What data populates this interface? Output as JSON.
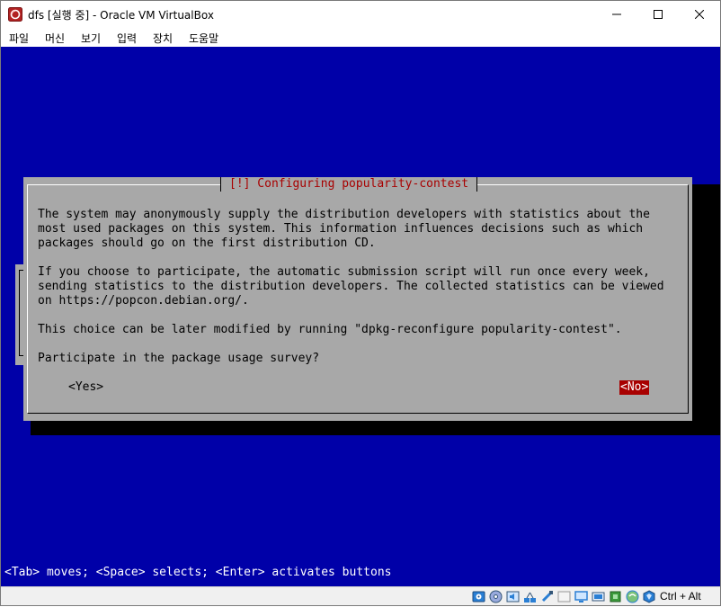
{
  "window": {
    "title": "dfs [실행 중] - Oracle VM VirtualBox",
    "accent_color": "#b22222"
  },
  "menu": {
    "items": [
      {
        "label": "파일"
      },
      {
        "label": "머신"
      },
      {
        "label": "보기"
      },
      {
        "label": "입력"
      },
      {
        "label": "장치"
      },
      {
        "label": "도움말"
      }
    ]
  },
  "installer": {
    "dialog_title": "[!] Configuring popularity-contest",
    "lines": [
      "The system may anonymously supply the distribution developers with statistics about the",
      "most used packages on this system. This information influences decisions such as which",
      "packages should go on the first distribution CD.",
      "",
      "If you choose to participate, the automatic submission script will run once every week,",
      "sending statistics to the distribution developers. The collected statistics can be viewed",
      "on https://popcon.debian.org/.",
      "",
      "This choice can be later modified by running \"dpkg-reconfigure popularity-contest\".",
      "",
      "Participate in the package usage survey?"
    ],
    "yes_label": "<Yes>",
    "no_label": "<No>",
    "selected_button": "No",
    "hint": "<Tab> moves; <Space> selects; <Enter> activates buttons",
    "colors": {
      "screen_bg": "#0000a8",
      "dialog_bg": "#a8a8a8",
      "title_fg": "#a80000",
      "selected_bg": "#a80000"
    }
  },
  "statusbar": {
    "icons": [
      "hard-disk-icon",
      "optical-drive-icon",
      "audio-icon",
      "network-icon",
      "usb-icon",
      "shared-folders-icon",
      "display-icon",
      "video-capture-icon",
      "cpu-icon",
      "mouse-integration-icon",
      "keyboard-icon",
      "mouse-icon"
    ],
    "host_key": "Ctrl + Alt"
  }
}
